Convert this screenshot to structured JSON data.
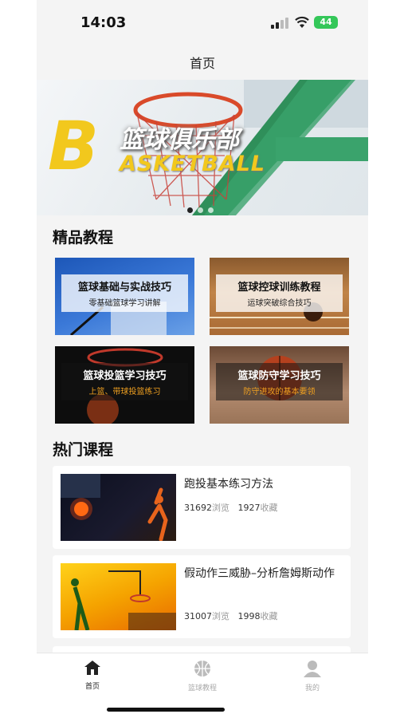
{
  "status_bar": {
    "time": "14:03",
    "battery": "44"
  },
  "nav": {
    "title": "首页"
  },
  "banner": {
    "letter": "B",
    "title": "篮球俱乐部",
    "subtitle": "ASKETBALL"
  },
  "featured": {
    "heading": "精品教程",
    "items": [
      {
        "title": "篮球基础与实战技巧",
        "subtitle": "零基础篮球学习讲解"
      },
      {
        "title": "篮球控球训练教程",
        "subtitle": "运球突破综合技巧"
      },
      {
        "title": "篮球投篮学习技巧",
        "subtitle": "上篮、带球投篮练习"
      },
      {
        "title": "篮球防守学习技巧",
        "subtitle": "防守进攻的基本要领"
      }
    ]
  },
  "popular": {
    "heading": "热门课程",
    "courses": [
      {
        "title": "跑投基本练习方法",
        "views": "31692",
        "views_unit": "浏览",
        "favs": "1927",
        "favs_unit": "收藏"
      },
      {
        "title": "假动作三威胁–分析詹姆斯动作",
        "views": "31007",
        "views_unit": "浏览",
        "favs": "1998",
        "favs_unit": "收藏"
      }
    ]
  },
  "tabbar": {
    "items": [
      {
        "label": "首页",
        "icon": "home-icon",
        "active": true
      },
      {
        "label": "篮球教程",
        "icon": "basketball-icon",
        "active": false
      },
      {
        "label": "我的",
        "icon": "person-icon",
        "active": false
      }
    ]
  },
  "colors": {
    "accent": "#f2c81d",
    "battery": "#34c759",
    "subtitle_orange": "#f0a020"
  }
}
